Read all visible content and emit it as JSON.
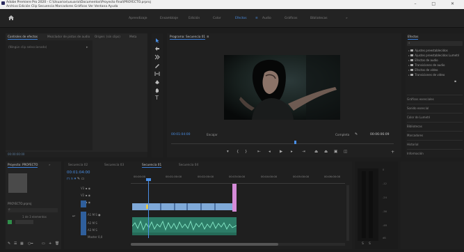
{
  "window": {
    "title": "Adobe Premiere Pro 2020 - C:\\Usuarios\\usuario\\Documentos\\Proyecto final\\PROYECTO.prproj",
    "menu": "Archivo   Edición   Clip   Secuencia   Marcadores   Gráficos   Ver   Ventana   Ayuda",
    "controls": "–  □  ✕"
  },
  "workspaces": {
    "items": [
      "Aprendizaje",
      "Ensamblaje",
      "Edición",
      "Color",
      "Efectos",
      "Audio",
      "Gráficos",
      "Bibliotecas"
    ],
    "active_index": 4,
    "more": "»"
  },
  "source_panel": {
    "tabs": [
      "Controles de efectos",
      "Mezclador de pistas de audio",
      "Origen: (sin clips)",
      "Meta"
    ],
    "active_tab": 0,
    "no_clip": "(Ningún clip seleccionado)",
    "time": "00:00:00:00"
  },
  "program_monitor": {
    "tab": "Programa: Secuencia 01",
    "timecode": "00:01:04:00",
    "fit": "Encajar",
    "quality": "Completa",
    "duration": "00:06:06:09"
  },
  "effects_panel": {
    "tab": "Efectos",
    "search_placeholder": "",
    "items": [
      "Ajustes preestablecidos",
      "Ajustes preestablecidos Lumetri",
      "Efectos de audio",
      "Transiciones de audio",
      "Efectos de vídeo",
      "Transiciones de vídeo"
    ],
    "sections": [
      "Gráficos esenciales",
      "Sonido esencial",
      "Color de Lumetri",
      "Bibliotecas",
      "Marcadores",
      "Historial",
      "Información"
    ]
  },
  "project_panel": {
    "tabs": [
      "Proyecto: PROYECTO",
      "Navegador"
    ],
    "item_name": "PROYECTO.prproj",
    "count": "1 de 3 elementos"
  },
  "timeline": {
    "tabs": [
      "Secuencia 02",
      "Secuencia 03",
      "Secuencia 01",
      "Secuencia 04"
    ],
    "active_tab": 2,
    "timecode": "00:01:04:00",
    "ruler": [
      "00:00:00",
      "00:01:00:00",
      "00:02:00:00",
      "00:03:00:00",
      "00:04:00:00",
      "00:05:00:00",
      "00:06:00:00"
    ],
    "tracks_video": [
      "V3",
      "V2",
      "V1"
    ],
    "tracks_audio": [
      "A1",
      "A2",
      "A3"
    ],
    "master": "Master",
    "master_value": "0,0"
  },
  "meter": {
    "scale": [
      "0",
      "-12",
      "-24",
      "-36",
      "-48",
      "dB"
    ]
  },
  "tools": [
    "selection-tool",
    "track-select-tool",
    "ripple-edit-tool",
    "razor-tool",
    "slip-tool",
    "pen-tool",
    "hand-tool",
    "type-tool"
  ],
  "colors": {
    "accent": "#3b7ed8",
    "video_clip": "#7fa9d8",
    "audio_clip": "#3fa38a",
    "marker": "#d58bd8",
    "playhead": "#4a8fe6"
  }
}
